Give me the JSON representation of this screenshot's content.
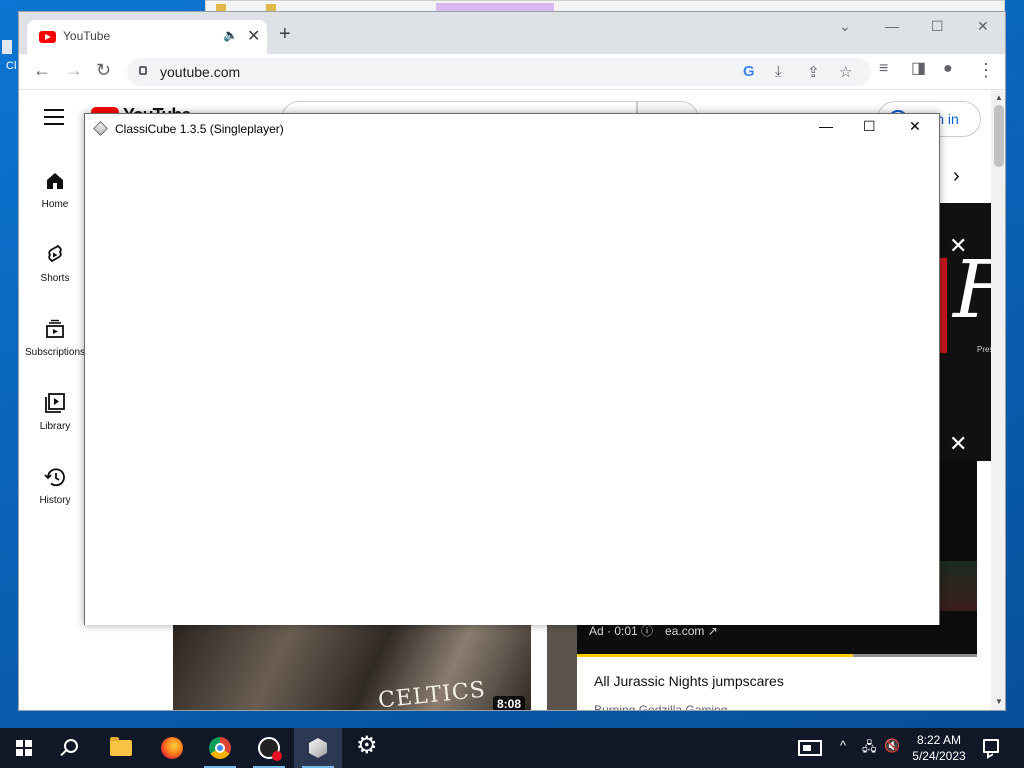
{
  "desktop": {
    "icon_fragment_label": "Cl"
  },
  "chrome": {
    "tab": {
      "title": "YouTube",
      "speaker_icon": "speaker-icon",
      "close_glyph": "✕"
    },
    "new_tab_glyph": "+",
    "window_controls": {
      "tabsearch_glyph": "⌄",
      "minimize_glyph": "—",
      "maximize_glyph": "☐",
      "close_glyph": "✕"
    },
    "toolbar": {
      "back_glyph": "←",
      "forward_glyph": "→",
      "reload_glyph": "↻",
      "url": "youtube.com",
      "google_glyph": "G",
      "install_glyph": "⤓",
      "share_glyph": "⇪",
      "star_glyph": "☆",
      "media_glyph": "≡",
      "sidepanel_glyph": "◨",
      "profile_glyph": "●",
      "menu_glyph": "⋮"
    }
  },
  "youtube": {
    "logo_text": "YouTube",
    "signin_label": "Sign in",
    "guide": [
      {
        "label": "Home",
        "icon": "home-icon"
      },
      {
        "label": "Shorts",
        "icon": "shorts-icon"
      },
      {
        "label": "Subscriptions",
        "icon": "subscriptions-icon"
      },
      {
        "label": "Library",
        "icon": "library-icon"
      },
      {
        "label": "History",
        "icon": "history-icon"
      }
    ],
    "chip_next_glyph": "›",
    "ad": {
      "banner_script": "F",
      "banner_small": "Pres",
      "close_glyph": "✕",
      "info_text": "Ad · 0:01 ⓘ",
      "link_text": "ea.com ↗",
      "progress_fraction": 0.69
    },
    "video": {
      "jersey_text": "CELTICS",
      "duration": "8:08"
    },
    "ad_card": {
      "title": "All Jurassic Nights jumpscares",
      "channel": "Burning Godzilla Gaming"
    },
    "scrollbar": {
      "up_glyph": "▲",
      "down_glyph": "▼"
    }
  },
  "classicube": {
    "title": "ClassiCube 1.3.5 (Singleplayer)",
    "minimize_glyph": "—",
    "maximize_glyph": "☐",
    "close_glyph": "✕"
  },
  "taskbar": {
    "apps": [
      {
        "name": "start",
        "icon": "windows-icon"
      },
      {
        "name": "search",
        "icon": "search-icon"
      },
      {
        "name": "file-explorer",
        "icon": "folder-icon"
      },
      {
        "name": "firefox",
        "icon": "firefox-icon"
      },
      {
        "name": "chrome",
        "icon": "chrome-icon"
      },
      {
        "name": "app",
        "icon": "app-icon"
      },
      {
        "name": "classicube",
        "icon": "cube-icon"
      },
      {
        "name": "settings",
        "icon": "gear-icon"
      }
    ],
    "tray": {
      "chevron_glyph": "^",
      "network_glyph": "🖧",
      "volume_glyph": "🔇"
    },
    "clock": {
      "time": "8:22 AM",
      "date": "5/24/2023"
    }
  }
}
